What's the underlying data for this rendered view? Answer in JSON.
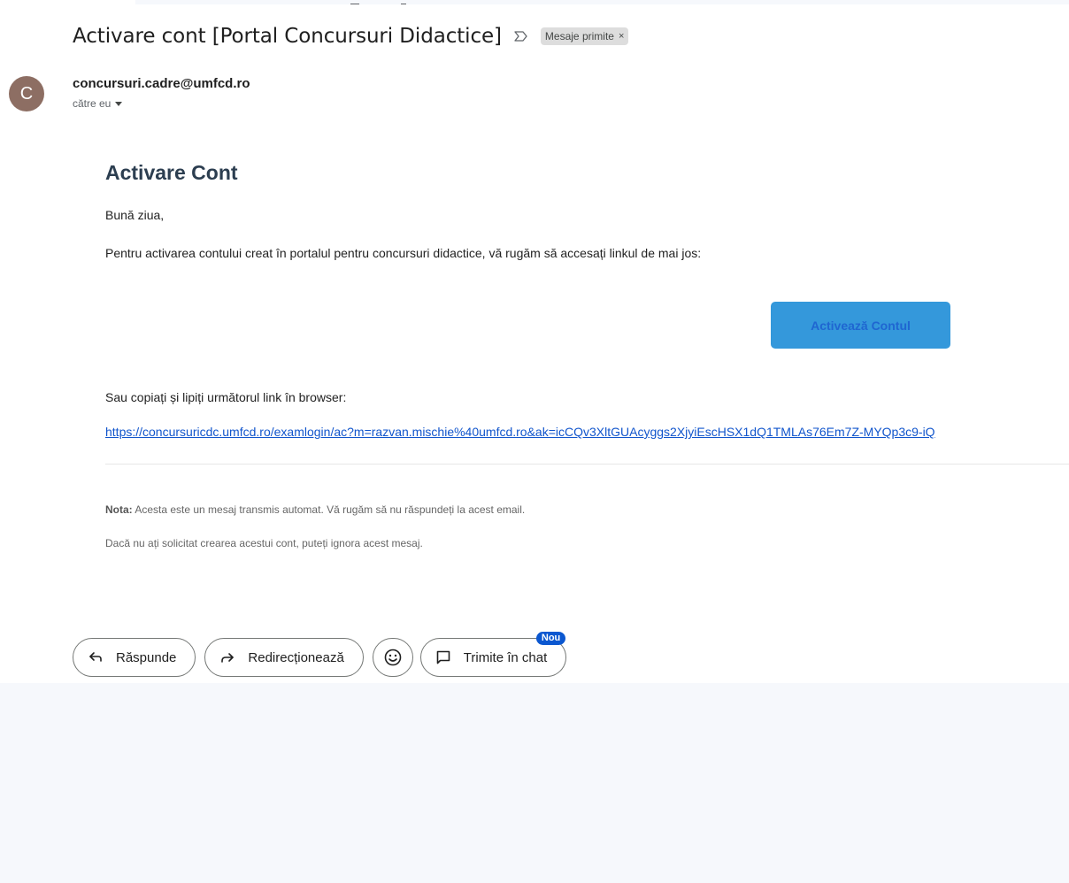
{
  "email": {
    "subject": "Activare cont [Portal Concursuri Didactice]",
    "label": "Mesaje primite",
    "label_close": "×",
    "sender_initial": "C",
    "sender": "concursuri.cadre@umfcd.ro",
    "recipients": "către eu"
  },
  "body": {
    "heading": "Activare Cont",
    "greeting": "Bună ziua,",
    "intro": "Pentru activarea contului creat în portalul pentru concursuri didactice, vă rugăm să accesați linkul de mai jos:",
    "button_label": "Activează Contul",
    "copy_hint": "Sau copiați și lipiți următorul link în browser:",
    "link": "https://concursuricdc.umfcd.ro/examlogin/ac?m=razvan.mischie%40umfcd.ro&ak=icCQv3XltGUAcyggs2XjyiEscHSX1dQ1TMLAs76Em7Z-MYQp3c9-iQ",
    "note_label": "Nota:",
    "note_text": " Acesta este un mesaj transmis automat. Vă rugăm să nu răspundeți la acest email.",
    "note2": "Dacă nu ați solicitat crearea acestui cont, puteți ignora acest mesaj."
  },
  "actions": {
    "reply": "Răspunde",
    "forward": "Redirecționează",
    "send_chat": "Trimite în chat",
    "new_badge": "Nou"
  },
  "colors": {
    "accent": "#0b57d0",
    "button": "#3498db",
    "avatar": "#8d6e63",
    "link": "#1155cc"
  }
}
